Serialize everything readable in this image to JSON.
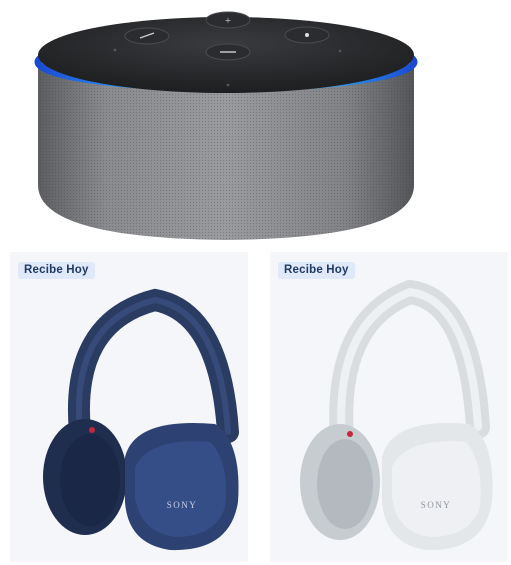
{
  "products": [
    {
      "badge": "Recibe Hoy",
      "brand": "SONY",
      "color": "#2b3c63"
    },
    {
      "badge": "Recibe Hoy",
      "brand": "SONY",
      "color": "#d9dde0"
    }
  ],
  "colors": {
    "accent_ring": "#2fa8ff",
    "speaker_fabric": "#7b7c7f",
    "badge_bg": "#dfe9f9",
    "badge_text": "#1f3a66"
  }
}
